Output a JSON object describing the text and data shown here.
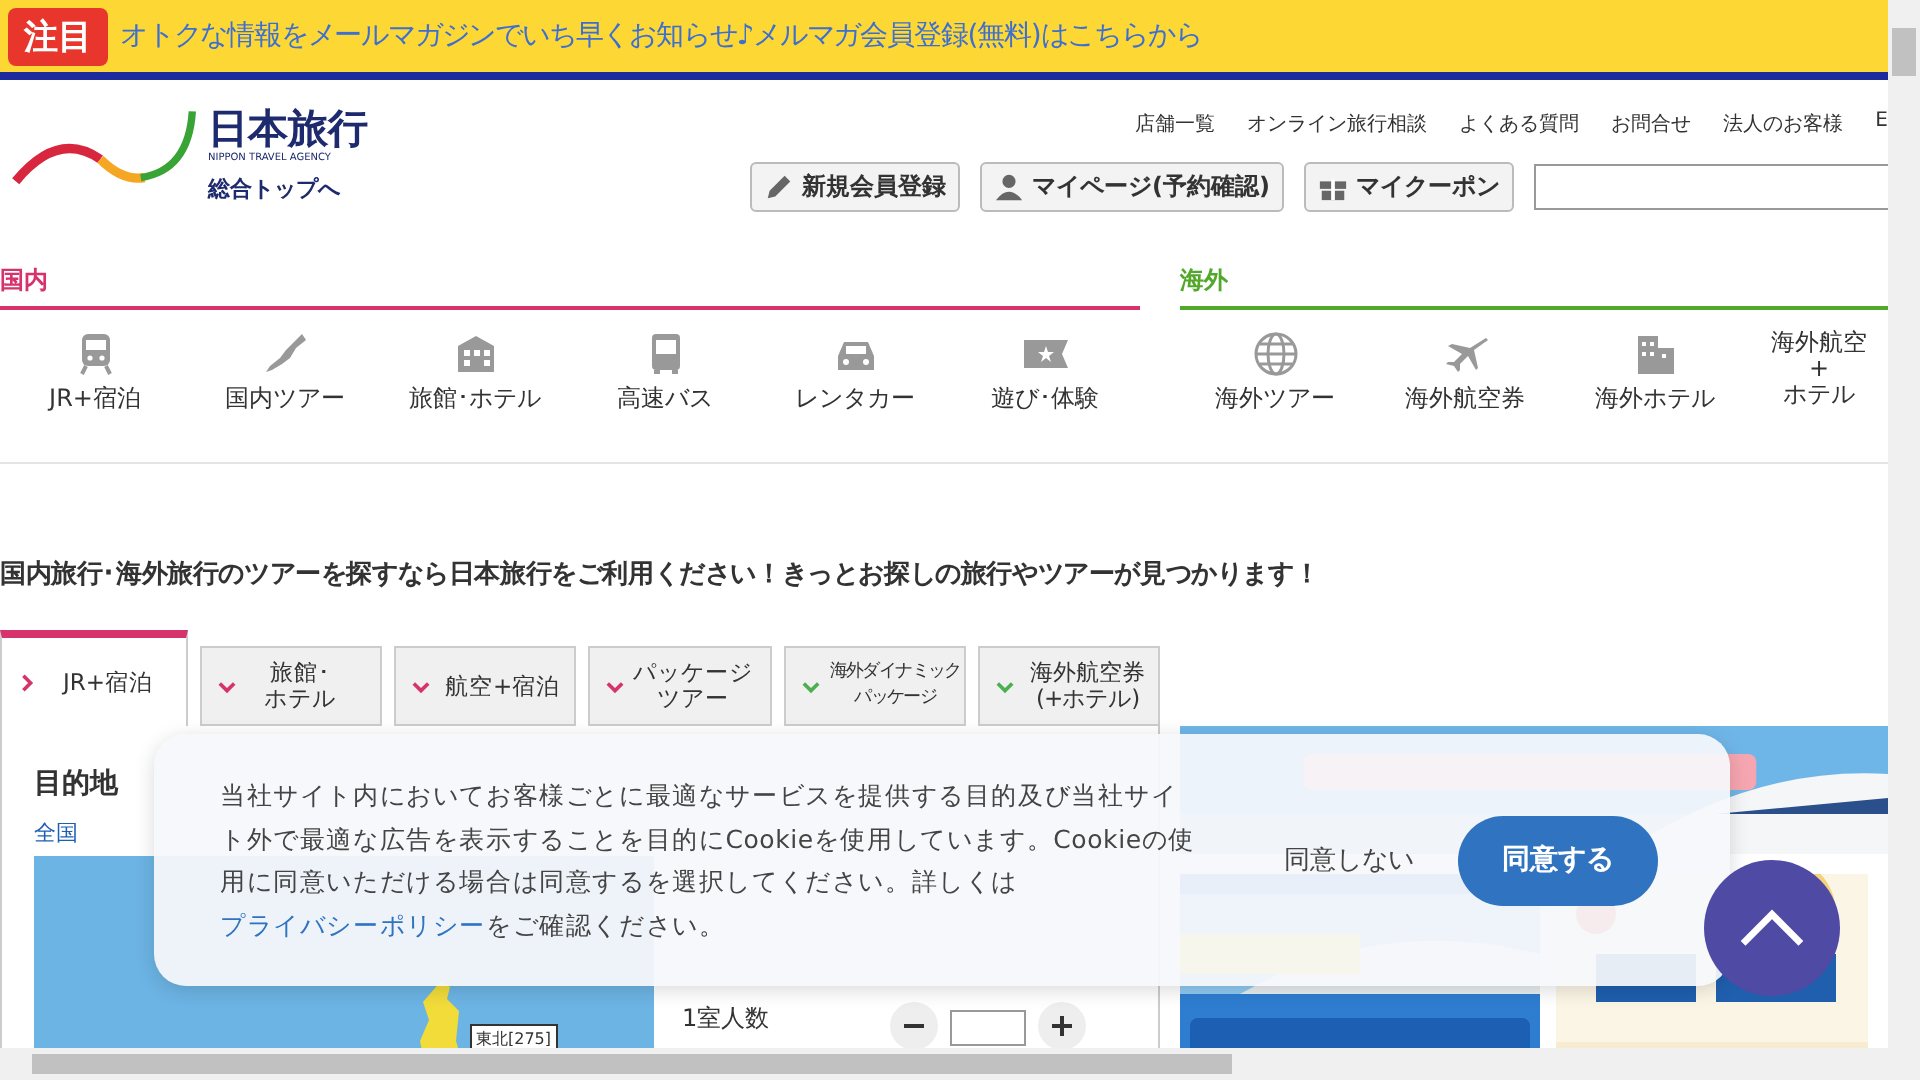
{
  "promo_bar": {
    "badge": "注目",
    "text": "オトクな情報をメールマガジンでいち早くお知らせ♪メルマガ会員登録(無料)はこちらから"
  },
  "logo": {
    "name": "日本旅行",
    "subtitle": "NIPPON TRAVEL AGENCY",
    "top_link": "総合トップへ"
  },
  "header_links": [
    "店舗一覧",
    "オンライン旅行相談",
    "よくある質問",
    "お問合せ",
    "法人のお客様",
    "E"
  ],
  "header_buttons": [
    "新規会員登録",
    "マイページ(予約確認)",
    "マイクーポン"
  ],
  "sections": [
    {
      "title": "国内",
      "color": "#d6336c",
      "items": [
        "JR+宿泊",
        "国内ツアー",
        "旅館･ホテル",
        "高速バス",
        "レンタカー",
        "遊び･体験"
      ]
    },
    {
      "title": "海外",
      "color": "#52a82a",
      "items": [
        "海外ツアー",
        "海外航空券",
        "海外ホテル",
        "海外航空\n+\nホテル"
      ]
    }
  ],
  "headline": "国内旅行･海外旅行のツアーを探すなら日本旅行をご利用ください！きっとお探しの旅行やツアーが見つかります！",
  "search_tabs": [
    {
      "label": "JR+宿泊",
      "selected": true,
      "color": "#d6336c",
      "small": false
    },
    {
      "label": "旅館･ホテル",
      "selected": false,
      "color": "#d6336c",
      "small": false
    },
    {
      "label": "航空+宿泊",
      "selected": false,
      "color": "#d6336c",
      "small": false
    },
    {
      "label": "パッケージツアー",
      "selected": false,
      "color": "#d6336c",
      "small": false
    },
    {
      "label": "海外ダイナミックパッケージ",
      "selected": false,
      "color": "#4caf50",
      "small": true
    },
    {
      "label": "海外航空券(+ホテル)",
      "selected": false,
      "color": "#4caf50",
      "small": false
    }
  ],
  "destination": {
    "title": "目的地",
    "region_link": "全国",
    "map_label": "東北[275]"
  },
  "form": {
    "rooms_label": "1室人数"
  },
  "cookie": {
    "text_before": "当社サイト内においてお客様ごとに最適なサービスを提供する目的及び当社サイト外で最適な広告を表示することを目的にCookieを使用しています。Cookieの使用に同意いただける場合は同意するを選択してください。詳しくは",
    "link": "プライバシーポリシー",
    "text_after": "をご確認ください。",
    "decline": "同意しない",
    "accept": "同意する"
  }
}
